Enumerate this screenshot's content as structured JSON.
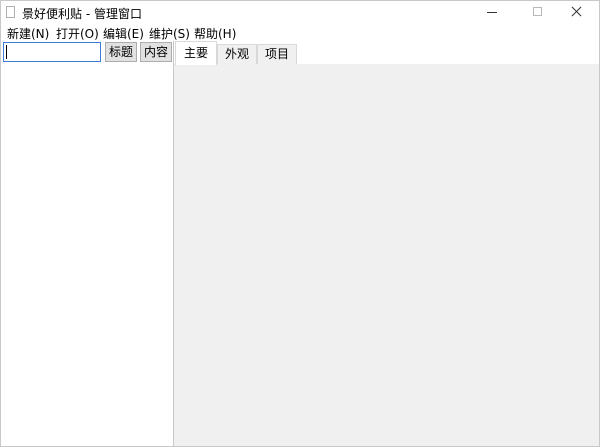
{
  "window": {
    "title": "景好便利贴 - 管理窗口",
    "icons": {
      "app": "note-icon",
      "minimize": "minimize-icon",
      "maximize": "maximize-icon",
      "close": "close-icon"
    }
  },
  "menu": {
    "items": [
      {
        "label": "新建(N)"
      },
      {
        "label": "打开(O)"
      },
      {
        "label": "编辑(E)"
      },
      {
        "label": "维护(S)"
      },
      {
        "label": "帮助(H)"
      }
    ]
  },
  "search": {
    "value": "",
    "placeholder": ""
  },
  "buttons": {
    "title": "标题",
    "content": "内容"
  },
  "tabs": [
    {
      "label": "主要",
      "active": true
    },
    {
      "label": "外观",
      "active": false
    },
    {
      "label": "项目",
      "active": false
    }
  ]
}
